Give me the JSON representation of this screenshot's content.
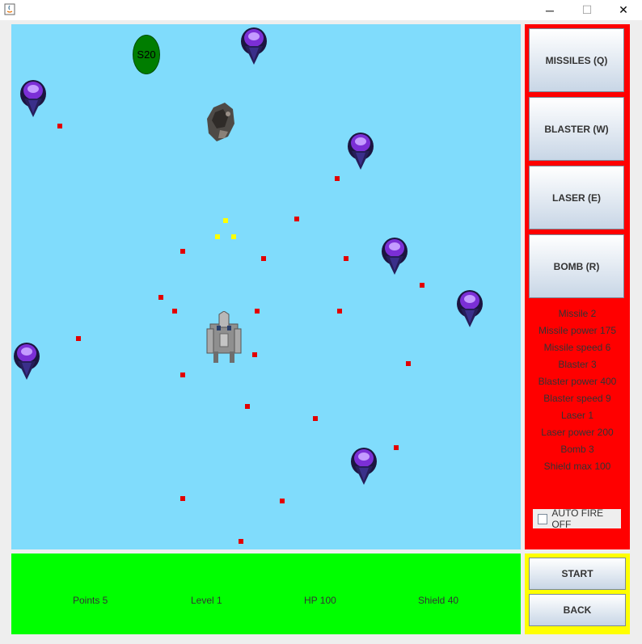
{
  "window": {
    "minimize_glyph": "─",
    "maximize_glyph": "☐",
    "close_glyph": "✕"
  },
  "game": {
    "bonus_label": "S20",
    "enemy_count": 9,
    "enemy_bullet_count": 26,
    "player_shot_count": 3
  },
  "weapons": [
    {
      "label": "MISSILES (Q)"
    },
    {
      "label": "BLASTER (W)"
    },
    {
      "label": "LASER (E)"
    },
    {
      "label": "BOMB (R)"
    }
  ],
  "stats": [
    "Missile 2",
    "Missile power 175",
    "Missile speed 6",
    "Blaster 3",
    "Blaster power 400",
    "Blaster speed 9",
    "Laser 1",
    "Laser power 200",
    "Bomb 3",
    "Shield max 100"
  ],
  "autofire": {
    "label": "AUTO FIRE OFF",
    "checked": false
  },
  "status": {
    "points": "Points 5",
    "level": "Level 1",
    "hp": "HP 100",
    "shield": "Shield 40"
  },
  "controls": {
    "start": "START",
    "back": "BACK"
  },
  "colors": {
    "play_area": "#80dcfc",
    "weapon_panel": "#ff0000",
    "status_bar": "#00ff00",
    "control_panel": "#ffff00",
    "enemy_bullet": "#e20000",
    "player_shot": "#ffff00",
    "bonus": "#007d00"
  }
}
